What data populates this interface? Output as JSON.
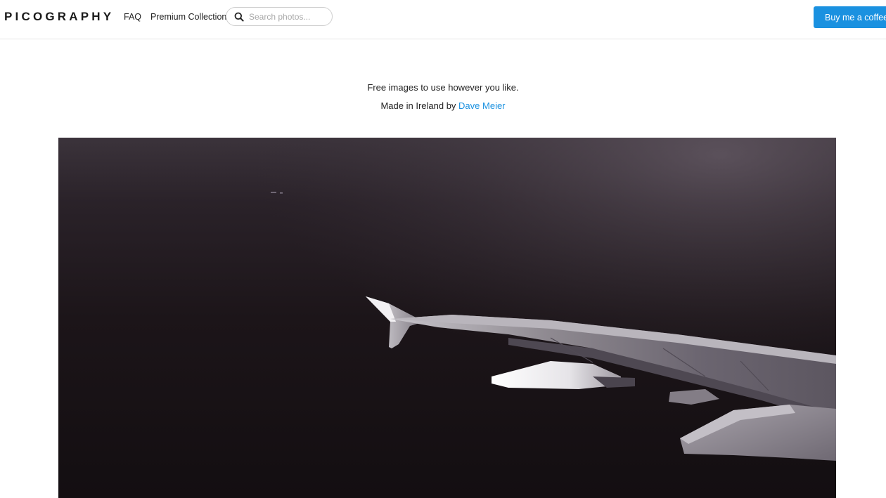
{
  "header": {
    "logo": "PICOGRAPHY",
    "nav": {
      "faq": "FAQ",
      "premium": "Premium Collections"
    },
    "search": {
      "placeholder": "Search photos..."
    },
    "cta_label": "Buy me a coffee"
  },
  "hero": {
    "tagline": "Free images to use however you like.",
    "credit_prefix": "Made in Ireland by",
    "credit_name": "Dave Meier"
  },
  "icons": {
    "search": "search-icon"
  },
  "colors": {
    "accent": "#1a91e0",
    "text": "#222222",
    "photo_dark": "#1a1418"
  }
}
